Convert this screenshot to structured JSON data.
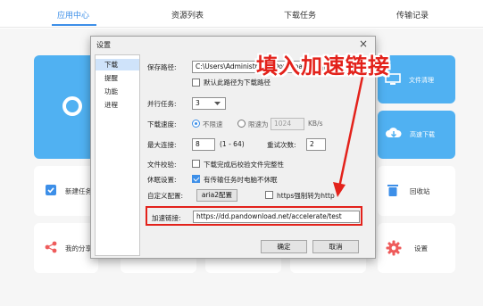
{
  "app": {
    "tabs": [
      {
        "label": "应用中心",
        "active": true
      },
      {
        "label": "资源列表",
        "active": false
      },
      {
        "label": "下载任务",
        "active": false
      },
      {
        "label": "传输记录",
        "active": false
      }
    ],
    "cards": {
      "file_cleanup": "文件清理",
      "hd_download": "高速下载",
      "new_task_partial": "新建任务",
      "recycle_bin": "回收站",
      "my_share_partial": "我的分享",
      "settings": "设置"
    },
    "accent_color": "#3d8fe8"
  },
  "dialog": {
    "title": "设置",
    "close_label": "×",
    "nav": [
      "下载",
      "提醒",
      "功能",
      "进程"
    ],
    "selected_nav": "下载",
    "save_path_label": "保存路径:",
    "save_path_value": "C:\\Users\\Administrator\\Downloads",
    "default_path_label": "默认此路径为下载路径",
    "parallel_label": "并行任务:",
    "parallel_value": "3",
    "speed_label": "下载速度:",
    "no_limit_label": "不限速",
    "limit_label": "限速为",
    "limit_value": "1024",
    "limit_unit": "KB/s",
    "max_conn_label": "最大连接:",
    "max_conn_value": "8",
    "max_conn_range": "(1 - 64)",
    "retry_label": "重试次数:",
    "retry_value": "2",
    "verify_label": "文件校验:",
    "verify_option": "下载完成后校验文件完整性",
    "sleep_label": "休眠设置:",
    "sleep_option": "有传输任务时电脑不休眠",
    "custom_label": "自定义配置:",
    "aria2_button": "aria2配置",
    "https_option": "https强制转为http",
    "accel_label": "加速链接:",
    "accel_value": "https://dd.pandownload.net/accelerate/test",
    "ok_button": "确定",
    "cancel_button": "取消"
  },
  "annotation": {
    "text": "填入加速链接",
    "color": "#e3221b"
  }
}
